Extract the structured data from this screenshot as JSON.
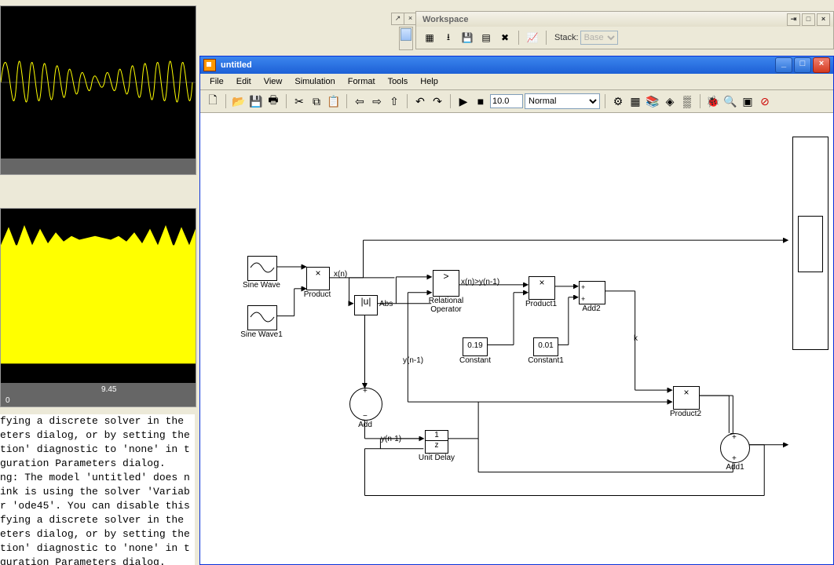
{
  "workspace": {
    "title": "Workspace",
    "stack_label": "Stack:",
    "stack_value": "Base"
  },
  "scope": {
    "tick1": "9.45",
    "tick2": "0"
  },
  "cmd_text": "fying a discrete solver in the\neters dialog, or by setting the\ntion' diagnostic to 'none' in t\nguration Parameters dialog.\nng: The model 'untitled' does n\nink is using the solver 'Variab\nr 'ode45'. You can disable this\nfying a discrete solver in the\neters dialog, or by setting the\ntion' diagnostic to 'none' in t\nguration Parameters dialog.",
  "simulink": {
    "title": "untitled",
    "menu": [
      "File",
      "Edit",
      "View",
      "Simulation",
      "Format",
      "Tools",
      "Help"
    ],
    "stop_time": "10.0",
    "mode": "Normal",
    "blocks": {
      "sine_wave": "Sine Wave",
      "sine_wave1": "Sine Wave1",
      "product": "Product",
      "product1": "Product1",
      "product2": "Product2",
      "abs_sym": "|u|",
      "abs": "Abs",
      "relop_sym": ">",
      "relop": "Relational\nOperator",
      "constant_val": "0.19",
      "constant": "Constant",
      "constant1_val": "0.01",
      "constant1": "Constant1",
      "add2": "Add2",
      "add1": "Add1",
      "unit_delay_top": "1",
      "unit_delay_bot": "z",
      "unit_delay": "Unit Delay",
      "add": "Add",
      "sig_xn": "x(n)",
      "sig_xy": "x(n)>y(n-1)",
      "sig_y1": "y(n-1)",
      "sig_y2": "y(n-1)",
      "sig_k": "k"
    }
  }
}
